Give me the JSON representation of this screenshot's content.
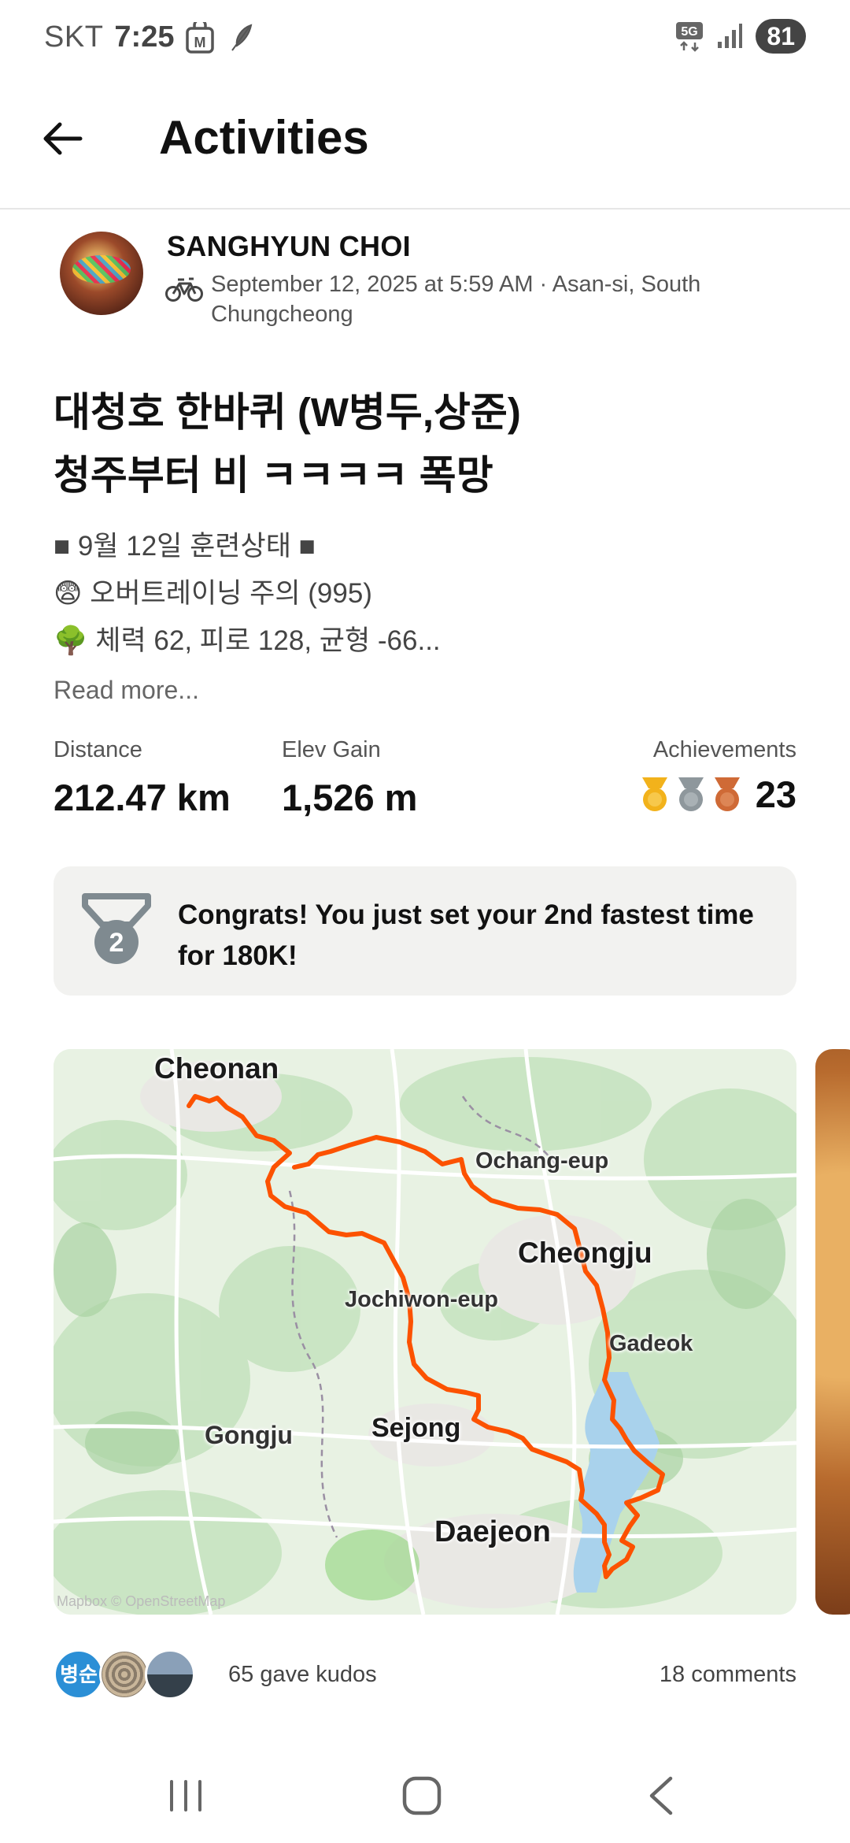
{
  "status_bar": {
    "carrier": "SKT",
    "time": "7:25",
    "network": "5G",
    "battery": "81",
    "icons": [
      "m-badge-icon",
      "notification-feather-icon",
      "5g-icon",
      "signal-icon",
      "battery-icon"
    ]
  },
  "header": {
    "title": "Activities",
    "back_icon": "arrow-left-icon"
  },
  "activity": {
    "athlete_name": "SANGHYUN CHOI",
    "sport_icon": "bicycle-icon",
    "meta": "September 12, 2025 at 5:59 AM · Asan-si, South Chungcheong",
    "title_line1": "대청호 한바퀴 (W병두,상준)",
    "title_line2": "청주부터 비 ㅋㅋㅋㅋ 폭망",
    "description": [
      "■ 9월 12일 훈련상태 ■",
      "😨 오버트레이닝 주의 (995)",
      "🌳 체력 62, 피로 128, 균형 -66..."
    ],
    "read_more": "Read more..."
  },
  "stats": {
    "distance_label": "Distance",
    "distance_value": "212.47 km",
    "elev_label": "Elev Gain",
    "elev_value": "1,526 m",
    "achievements_label": "Achievements",
    "achievements_count": "23",
    "medal_colors": [
      "#f2b21b",
      "#8e979c",
      "#cf6a36"
    ]
  },
  "congrats": {
    "icon": "silver-medal-2-icon",
    "medal_number": "2",
    "text": "Congrats! You just set your 2nd fastest time for 180K!"
  },
  "map": {
    "labels": [
      "Cheonan",
      "Ochang-eup",
      "Cheongju",
      "Jochiwon-eup",
      "Gadeok",
      "Gongju",
      "Sejong",
      "Daejeon"
    ],
    "attribution": "Mapbox © OpenStreetMap",
    "route_color": "#fc5200"
  },
  "social": {
    "kudos_avatar_initials": "병순",
    "kudos": "65 gave kudos",
    "comments": "18 comments"
  },
  "nav_bar": {
    "icons": [
      "recent-apps-icon",
      "home-icon",
      "back-icon"
    ]
  }
}
